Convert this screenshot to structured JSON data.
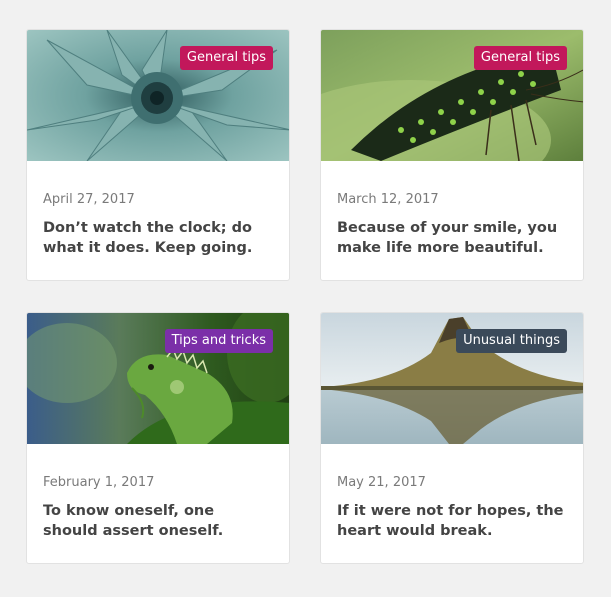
{
  "cards": [
    {
      "category": "General tips",
      "category_color": "#c2185b",
      "date": "April 27, 2017",
      "title": "Don’t watch the clock; do what it does. Keep going.",
      "image": "succulent-photo"
    },
    {
      "category": "General tips",
      "category_color": "#c2185b",
      "date": "March 12, 2017",
      "title": "Because of your smile, you make life more beautiful.",
      "image": "butterfly-photo"
    },
    {
      "category": "Tips and tricks",
      "category_color": "#7b2fa8",
      "date": "February 1, 2017",
      "title": "To know oneself, one should assert oneself.",
      "image": "iguana-photo"
    },
    {
      "category": "Unusual things",
      "category_color": "#3b4a5a",
      "date": "May 21, 2017",
      "title": "If it were not for hopes, the heart would break.",
      "image": "mountain-lake-photo"
    }
  ]
}
